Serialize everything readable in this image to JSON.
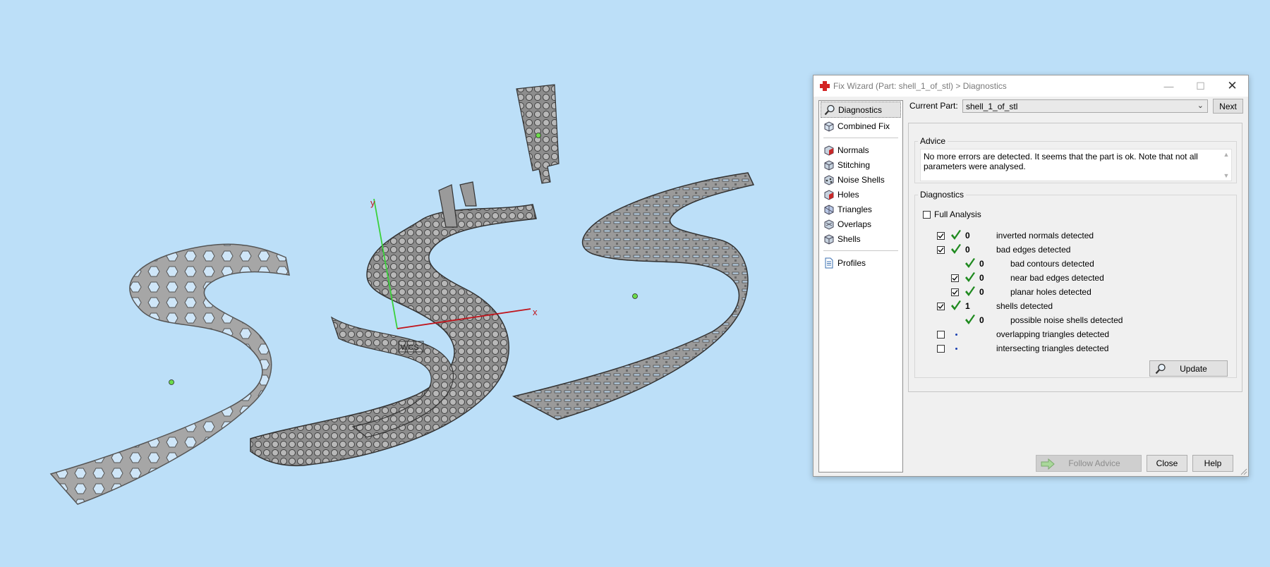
{
  "viewport": {
    "axis_x_label": "x",
    "axis_y_label": "y",
    "origin_label": "WCS"
  },
  "window": {
    "title": "Fix Wizard (Part: shell_1_of_stl) > Diagnostics",
    "title_icon": "red-cross-icon"
  },
  "nav": {
    "items": [
      {
        "label": "Diagnostics",
        "icon": "magnifier-icon"
      },
      {
        "label": "Combined Fix",
        "icon": "cube-icon"
      },
      {
        "label": "Normals",
        "icon": "normals-cube-icon"
      },
      {
        "label": "Stitching",
        "icon": "stitching-cube-icon"
      },
      {
        "label": "Noise Shells",
        "icon": "noise-shells-icon"
      },
      {
        "label": "Holes",
        "icon": "holes-cube-icon"
      },
      {
        "label": "Triangles",
        "icon": "triangles-cube-icon"
      },
      {
        "label": "Overlaps",
        "icon": "overlaps-cube-icon"
      },
      {
        "label": "Shells",
        "icon": "shells-cube-icon"
      },
      {
        "label": "Profiles",
        "icon": "document-icon"
      }
    ]
  },
  "current_part": {
    "label": "Current Part:",
    "value": "shell_1_of_stl",
    "next_label": "Next"
  },
  "advice": {
    "legend": "Advice",
    "text": "No more errors are detected. It seems that the part is ok. Note that not all parameters were analysed."
  },
  "diagnostics": {
    "legend": "Diagnostics",
    "full_analysis_label": "Full Analysis",
    "rows": [
      {
        "count": "0",
        "label": "inverted normals detected"
      },
      {
        "count": "0",
        "label": "bad edges detected"
      },
      {
        "count": "0",
        "label": "bad contours detected"
      },
      {
        "count": "0",
        "label": "near bad edges detected"
      },
      {
        "count": "0",
        "label": "planar holes detected"
      },
      {
        "count": "1",
        "label": "shells detected"
      },
      {
        "count": "0",
        "label": "possible noise shells detected"
      },
      {
        "count": "",
        "label": "overlapping triangles detected"
      },
      {
        "count": "",
        "label": "intersecting triangles detected"
      }
    ],
    "update_label": "Update"
  },
  "footer": {
    "follow_advice_label": "Follow Advice",
    "close_label": "Close",
    "help_label": "Help"
  },
  "colors": {
    "background": "#bcdff8",
    "part_gray": "#a8a8a8",
    "check_green": "#1f8a1f",
    "x_axis": "#c0141c",
    "y_axis": "#3ad13a"
  }
}
